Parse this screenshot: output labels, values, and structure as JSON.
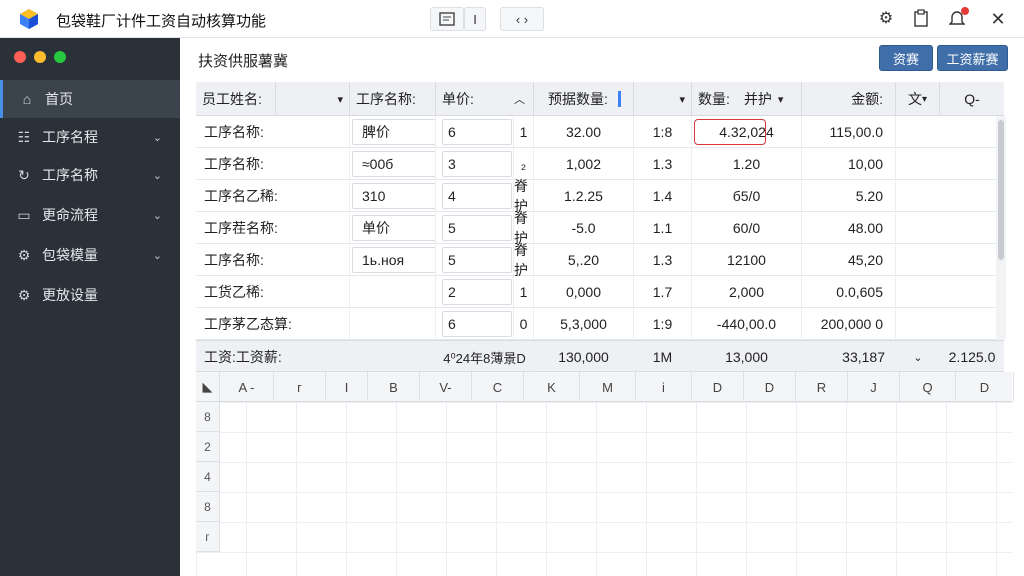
{
  "window": {
    "title": "包袋鞋厂计件工资自动核算功能",
    "toolbar_btn2": "I",
    "toolbar_btn3": "‹ ›"
  },
  "sidebar": {
    "items": [
      {
        "label": "首页",
        "icon": "home-icon",
        "active": true
      },
      {
        "label": "工序名程",
        "icon": "people-icon",
        "chevron": true
      },
      {
        "label": "工序名称",
        "icon": "refresh-icon",
        "chevron": true
      },
      {
        "label": "更命流程",
        "icon": "monitor-icon",
        "chevron": true
      },
      {
        "label": "包袋模量",
        "icon": "gear-icon",
        "chevron": true
      },
      {
        "label": "更放设量",
        "icon": "gear-icon",
        "chevron": false
      }
    ]
  },
  "main": {
    "title": "扶资供服薯冀",
    "btn_primary": "资赛",
    "btn_secondary": "工资薪赛"
  },
  "table": {
    "headers": [
      "员工姓名:",
      "",
      "工序名称:",
      "单价:",
      "预据数量:",
      "",
      "数量:　并护",
      "",
      "金额:",
      "文",
      "Q-"
    ],
    "rows": [
      [
        "工序名称:",
        "脾价",
        "6",
        "1",
        "32.00",
        "1:8",
        "4.32,024",
        "115,00.0"
      ],
      [
        "工序名称:",
        "≈00б",
        "3",
        "₂",
        "1,002",
        "1.3",
        "1.20",
        "10,00"
      ],
      [
        "工序名乙稀:",
        "310",
        "4",
        "脊护",
        "1.2.25",
        "1.4",
        "б5/0",
        "5.20"
      ],
      [
        "工序茬名称:",
        "单价",
        "5",
        "脊护",
        "-5.0",
        "1.1",
        "60/0",
        "48.00"
      ],
      [
        "工序名称:",
        "1ь.ноя",
        "5",
        "脊护",
        "5,.20",
        "1.3",
        "12100",
        "45,20"
      ],
      [
        "工货乙稀:",
        "",
        "2",
        "1",
        "0,000",
        "1.7",
        "2,000",
        "0.0,605"
      ],
      [
        "工序茅乙态算:",
        "",
        "6",
        "0",
        "5,3,000",
        "1:9",
        "-440,00.0",
        "200,000 0"
      ]
    ],
    "summary": [
      "工资:工资薪:",
      "4⁰24年8薄景D",
      "130,000",
      "1M",
      "13,000",
      "33,187",
      "2.125.0"
    ]
  },
  "sheet": {
    "columns": [
      "A -",
      "г",
      "I",
      "B",
      "V-",
      "C",
      "K",
      "M",
      "i",
      "D",
      "D",
      "R",
      "J",
      "Q",
      "D"
    ],
    "rows": [
      "8",
      "2",
      "4",
      "8",
      "г"
    ]
  },
  "colors": {
    "sidebar_bg": "#2b3138",
    "accent": "#3f6ea8",
    "highlight_border": "#d9393b"
  }
}
